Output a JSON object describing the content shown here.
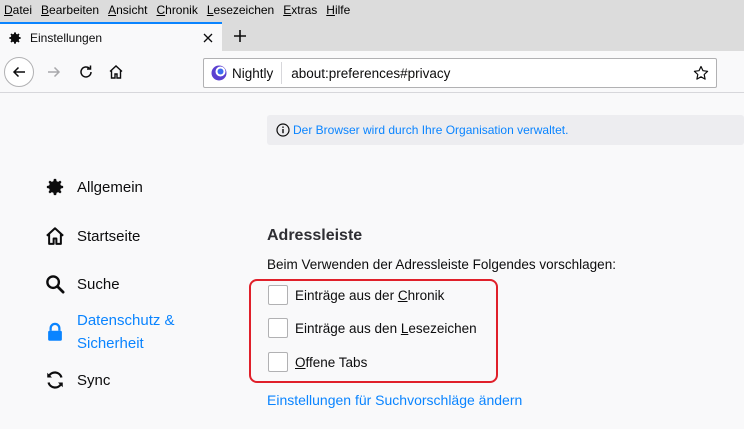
{
  "menubar": {
    "items": [
      {
        "label": "Datei",
        "accel": "D",
        "rest": "atei"
      },
      {
        "label": "Bearbeiten",
        "accel": "B",
        "rest": "earbeiten"
      },
      {
        "label": "Ansicht",
        "accel": "A",
        "rest": "nsicht"
      },
      {
        "label": "Chronik",
        "accel": "C",
        "rest": "hronik"
      },
      {
        "label": "Lesezeichen",
        "accel": "L",
        "rest": "esezeichen"
      },
      {
        "label": "Extras",
        "accel": "E",
        "rest": "xtras"
      },
      {
        "label": "Hilfe",
        "accel": "H",
        "rest": "ilfe"
      }
    ]
  },
  "tab": {
    "title": "Einstellungen",
    "icon": "gear-icon",
    "close": "✕",
    "new_tab": "+"
  },
  "navbar": {
    "identity_label": "Nightly",
    "url": "about:preferences#privacy"
  },
  "policy_notice": "Der Browser wird durch Ihre Organisation verwaltet.",
  "sidebar": {
    "items": [
      {
        "label": "Allgemein",
        "icon": "gear-icon"
      },
      {
        "label": "Startseite",
        "icon": "home-icon"
      },
      {
        "label": "Suche",
        "icon": "search-icon"
      },
      {
        "label": "Datenschutz &",
        "label2": "Sicherheit",
        "icon": "lock-icon",
        "active": true
      },
      {
        "label": "Sync",
        "icon": "sync-icon"
      }
    ]
  },
  "section": {
    "title": "Adressleiste",
    "description": "Beim Verwenden der Adressleiste Folgendes vorschlagen:",
    "options": [
      {
        "pre": "Einträge aus der ",
        "accel": "C",
        "post": "hronik",
        "checked": false
      },
      {
        "pre": "Einträge aus den ",
        "accel": "L",
        "post": "esezeichen",
        "checked": false
      },
      {
        "pre": "",
        "accel": "O",
        "post": "ffene Tabs",
        "checked": false
      }
    ],
    "link": "Einstellungen für Suchvorschläge ändern"
  },
  "colors": {
    "accent": "#0a84ff",
    "highlight_border": "#e0202a"
  }
}
